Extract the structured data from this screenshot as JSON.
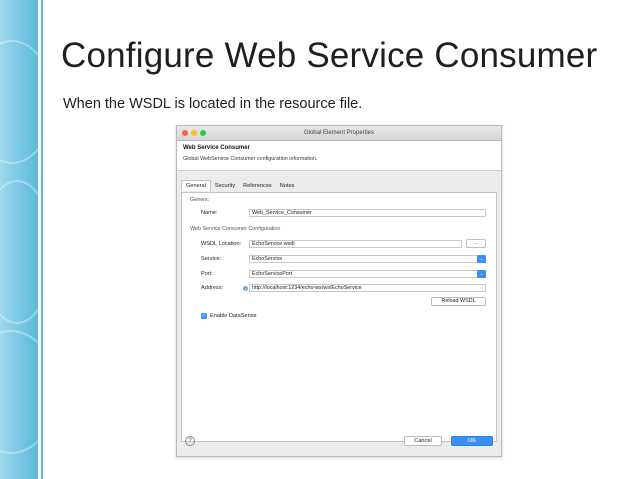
{
  "slide": {
    "title": "Configure Web Service Consumer",
    "subtitle": "When the WSDL is located in the resource file."
  },
  "dialog": {
    "window_title": "Global Element Properties",
    "header_title": "Web Service Consumer",
    "header_description": "Global WebService Consumer configuration information.",
    "tabs": [
      {
        "label": "General",
        "active": true
      },
      {
        "label": "Security",
        "active": false
      },
      {
        "label": "References",
        "active": false
      },
      {
        "label": "Notes",
        "active": false
      }
    ],
    "generic_group": "Generic",
    "name_label": "Name:",
    "name_value": "Web_Service_Consumer",
    "config_group": "Web Service Consumer Configuration",
    "wsdl_label": "WSDL Location:",
    "wsdl_value": "EchoService.wsdl",
    "browse_label": "...",
    "service_label": "Service:",
    "service_value": "EchoService",
    "port_label": "Port:",
    "port_value": "EchoServicePort",
    "address_label": "Address:",
    "address_value": "http://localhost:1234/echo-ws/ws/EchoService",
    "reload_label": "Reload WSDL",
    "datasense_label": "Enable DataSense",
    "datasense_checked": true,
    "help_glyph": "?",
    "cancel_label": "Cancel",
    "ok_label": "OK"
  },
  "colors": {
    "accent_blue": "#3a8ef6",
    "slide_band": "#7fcbe6",
    "close_red": "#fc5f57",
    "minimize_yellow": "#fdbc2e",
    "zoom_green": "#29c841"
  },
  "icons": [
    "close-icon",
    "minimize-icon",
    "zoom-icon",
    "chevron-down-icon",
    "info-icon",
    "checkbox-checked-icon",
    "help-icon"
  ]
}
